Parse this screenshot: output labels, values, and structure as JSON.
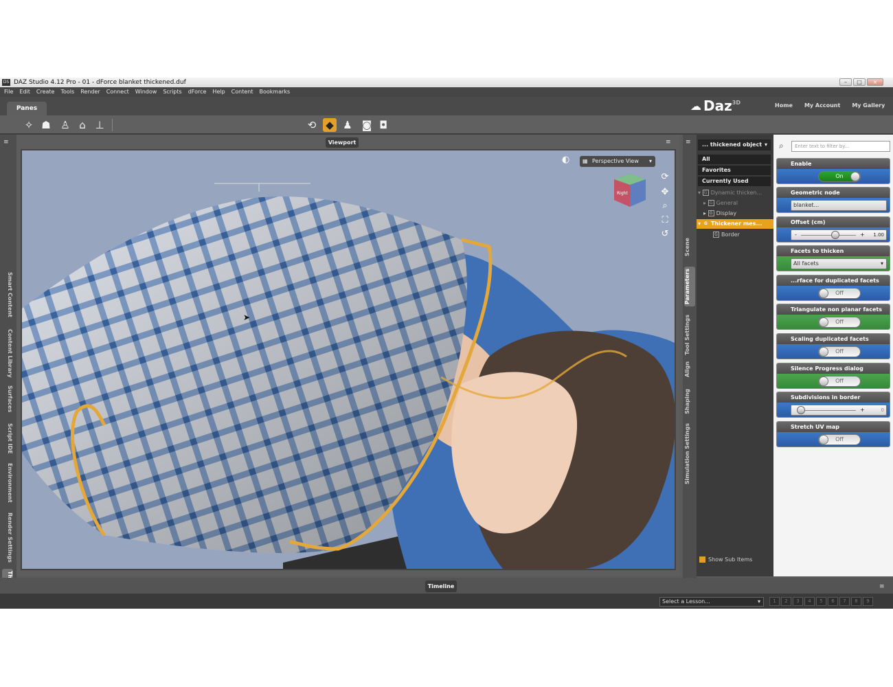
{
  "window": {
    "title": "DAZ Studio 4.12 Pro - 01 - dForce blanket thickened.duf",
    "app_icon": "DS",
    "min": "–",
    "max": "□",
    "close": "×"
  },
  "menu": [
    "File",
    "Edit",
    "Create",
    "Tools",
    "Render",
    "Connect",
    "Window",
    "Scripts",
    "dForce",
    "Help",
    "Content",
    "Bookmarks"
  ],
  "panes_tab": "Panes",
  "brand": {
    "logo": "Daz",
    "logo_sup": "3D",
    "links": [
      "Home",
      "My Account",
      "My Gallery"
    ]
  },
  "left_tabs": [
    "Smart Content",
    "Content Library",
    "Surfaces",
    "Script IDE",
    "Environment",
    "Render Settings",
    "Thickener"
  ],
  "viewport": {
    "label": "Viewport",
    "view_mode": "Perspective View",
    "view_cube_text": "Right",
    "bg_color": "#98a5bf"
  },
  "right_tabs": [
    "Scene",
    "Parameters",
    "Tool Settings",
    "Align",
    "Shaping",
    "Simulation Settings"
  ],
  "scene": {
    "selected_node": "... thickened object",
    "categories": [
      "All",
      "Favorites",
      "Currently Used"
    ],
    "tree": [
      {
        "label": "Dynamic thicken...",
        "state": "dim"
      },
      {
        "label": "General",
        "state": "dim"
      },
      {
        "label": "Display",
        "state": "normal"
      },
      {
        "label": "Thickener mes...",
        "state": "highlight"
      },
      {
        "label": "Border",
        "state": "normal"
      }
    ],
    "show_sub_items": "Show Sub Items"
  },
  "params": {
    "filter_placeholder": "Enter text to filter by...",
    "enable": {
      "title": "Enable",
      "value": "On"
    },
    "geometric_node": {
      "title": "Geometric node",
      "value": "blanket..."
    },
    "offset": {
      "title": "Offset (cm)",
      "value": "1.00",
      "minus": "-",
      "plus": "+",
      "level": 0.62
    },
    "facets": {
      "title": "Facets to thicken",
      "value": "All facets"
    },
    "surface_dup": {
      "title": "...rface for duplicated facets",
      "value": "Off"
    },
    "triangulate": {
      "title": "Triangulate non planar facets",
      "value": "Off"
    },
    "scaling": {
      "title": "Scaling duplicated facets",
      "value": "Off"
    },
    "silence": {
      "title": "Silence Progress dialog",
      "value": "Off"
    },
    "subdiv": {
      "title": "Subdivisions in border",
      "value": "0",
      "minus": "-",
      "plus": "+",
      "level": 0.0
    },
    "stretch": {
      "title": "Stretch UV map",
      "value": "Off"
    }
  },
  "timeline": {
    "label": "Timeline",
    "lesson_placeholder": "Select a Lesson...",
    "lesson_arrow": "▾",
    "pages": [
      "1",
      "2",
      "3",
      "4",
      "5",
      "6",
      "7",
      "8",
      "9"
    ]
  }
}
